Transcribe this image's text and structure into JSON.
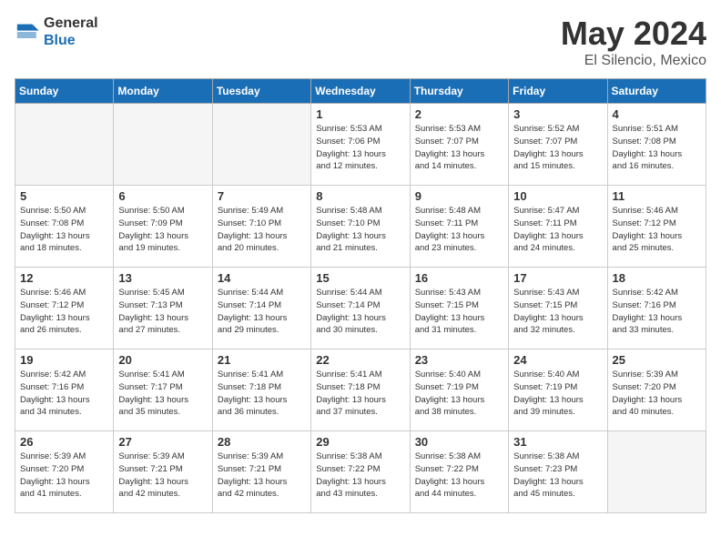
{
  "header": {
    "logo_general": "General",
    "logo_blue": "Blue",
    "month_title": "May 2024",
    "location": "El Silencio, Mexico"
  },
  "weekdays": [
    "Sunday",
    "Monday",
    "Tuesday",
    "Wednesday",
    "Thursday",
    "Friday",
    "Saturday"
  ],
  "weeks": [
    [
      {
        "day": "",
        "info": ""
      },
      {
        "day": "",
        "info": ""
      },
      {
        "day": "",
        "info": ""
      },
      {
        "day": "1",
        "info": "Sunrise: 5:53 AM\nSunset: 7:06 PM\nDaylight: 13 hours\nand 12 minutes."
      },
      {
        "day": "2",
        "info": "Sunrise: 5:53 AM\nSunset: 7:07 PM\nDaylight: 13 hours\nand 14 minutes."
      },
      {
        "day": "3",
        "info": "Sunrise: 5:52 AM\nSunset: 7:07 PM\nDaylight: 13 hours\nand 15 minutes."
      },
      {
        "day": "4",
        "info": "Sunrise: 5:51 AM\nSunset: 7:08 PM\nDaylight: 13 hours\nand 16 minutes."
      }
    ],
    [
      {
        "day": "5",
        "info": "Sunrise: 5:50 AM\nSunset: 7:08 PM\nDaylight: 13 hours\nand 18 minutes."
      },
      {
        "day": "6",
        "info": "Sunrise: 5:50 AM\nSunset: 7:09 PM\nDaylight: 13 hours\nand 19 minutes."
      },
      {
        "day": "7",
        "info": "Sunrise: 5:49 AM\nSunset: 7:10 PM\nDaylight: 13 hours\nand 20 minutes."
      },
      {
        "day": "8",
        "info": "Sunrise: 5:48 AM\nSunset: 7:10 PM\nDaylight: 13 hours\nand 21 minutes."
      },
      {
        "day": "9",
        "info": "Sunrise: 5:48 AM\nSunset: 7:11 PM\nDaylight: 13 hours\nand 23 minutes."
      },
      {
        "day": "10",
        "info": "Sunrise: 5:47 AM\nSunset: 7:11 PM\nDaylight: 13 hours\nand 24 minutes."
      },
      {
        "day": "11",
        "info": "Sunrise: 5:46 AM\nSunset: 7:12 PM\nDaylight: 13 hours\nand 25 minutes."
      }
    ],
    [
      {
        "day": "12",
        "info": "Sunrise: 5:46 AM\nSunset: 7:12 PM\nDaylight: 13 hours\nand 26 minutes."
      },
      {
        "day": "13",
        "info": "Sunrise: 5:45 AM\nSunset: 7:13 PM\nDaylight: 13 hours\nand 27 minutes."
      },
      {
        "day": "14",
        "info": "Sunrise: 5:44 AM\nSunset: 7:14 PM\nDaylight: 13 hours\nand 29 minutes."
      },
      {
        "day": "15",
        "info": "Sunrise: 5:44 AM\nSunset: 7:14 PM\nDaylight: 13 hours\nand 30 minutes."
      },
      {
        "day": "16",
        "info": "Sunrise: 5:43 AM\nSunset: 7:15 PM\nDaylight: 13 hours\nand 31 minutes."
      },
      {
        "day": "17",
        "info": "Sunrise: 5:43 AM\nSunset: 7:15 PM\nDaylight: 13 hours\nand 32 minutes."
      },
      {
        "day": "18",
        "info": "Sunrise: 5:42 AM\nSunset: 7:16 PM\nDaylight: 13 hours\nand 33 minutes."
      }
    ],
    [
      {
        "day": "19",
        "info": "Sunrise: 5:42 AM\nSunset: 7:16 PM\nDaylight: 13 hours\nand 34 minutes."
      },
      {
        "day": "20",
        "info": "Sunrise: 5:41 AM\nSunset: 7:17 PM\nDaylight: 13 hours\nand 35 minutes."
      },
      {
        "day": "21",
        "info": "Sunrise: 5:41 AM\nSunset: 7:18 PM\nDaylight: 13 hours\nand 36 minutes."
      },
      {
        "day": "22",
        "info": "Sunrise: 5:41 AM\nSunset: 7:18 PM\nDaylight: 13 hours\nand 37 minutes."
      },
      {
        "day": "23",
        "info": "Sunrise: 5:40 AM\nSunset: 7:19 PM\nDaylight: 13 hours\nand 38 minutes."
      },
      {
        "day": "24",
        "info": "Sunrise: 5:40 AM\nSunset: 7:19 PM\nDaylight: 13 hours\nand 39 minutes."
      },
      {
        "day": "25",
        "info": "Sunrise: 5:39 AM\nSunset: 7:20 PM\nDaylight: 13 hours\nand 40 minutes."
      }
    ],
    [
      {
        "day": "26",
        "info": "Sunrise: 5:39 AM\nSunset: 7:20 PM\nDaylight: 13 hours\nand 41 minutes."
      },
      {
        "day": "27",
        "info": "Sunrise: 5:39 AM\nSunset: 7:21 PM\nDaylight: 13 hours\nand 42 minutes."
      },
      {
        "day": "28",
        "info": "Sunrise: 5:39 AM\nSunset: 7:21 PM\nDaylight: 13 hours\nand 42 minutes."
      },
      {
        "day": "29",
        "info": "Sunrise: 5:38 AM\nSunset: 7:22 PM\nDaylight: 13 hours\nand 43 minutes."
      },
      {
        "day": "30",
        "info": "Sunrise: 5:38 AM\nSunset: 7:22 PM\nDaylight: 13 hours\nand 44 minutes."
      },
      {
        "day": "31",
        "info": "Sunrise: 5:38 AM\nSunset: 7:23 PM\nDaylight: 13 hours\nand 45 minutes."
      },
      {
        "day": "",
        "info": ""
      }
    ]
  ]
}
